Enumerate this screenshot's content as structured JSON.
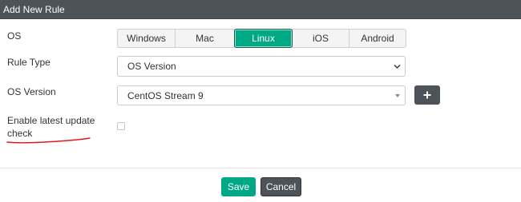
{
  "dialog": {
    "title": "Add New Rule"
  },
  "form": {
    "os": {
      "label": "OS",
      "options": [
        "Windows",
        "Mac",
        "Linux",
        "iOS",
        "Android"
      ],
      "selected": "Linux"
    },
    "rule_type": {
      "label": "Rule Type",
      "value": "OS Version"
    },
    "os_version": {
      "label": "OS Version",
      "value": "CentOS Stream 9",
      "add_label": "+"
    },
    "latest_update": {
      "label_line1": "Enable latest update",
      "label_line2": "check",
      "checked": false
    }
  },
  "footer": {
    "save_label": "Save",
    "cancel_label": "Cancel"
  },
  "colors": {
    "accent": "#00a886",
    "dark": "#4d5358",
    "annotation": "#e0191e"
  },
  "icons": {
    "rule_type_dropdown": "chevron-down-icon",
    "os_version_dropdown": "caret-down-icon",
    "add": "plus-icon"
  }
}
